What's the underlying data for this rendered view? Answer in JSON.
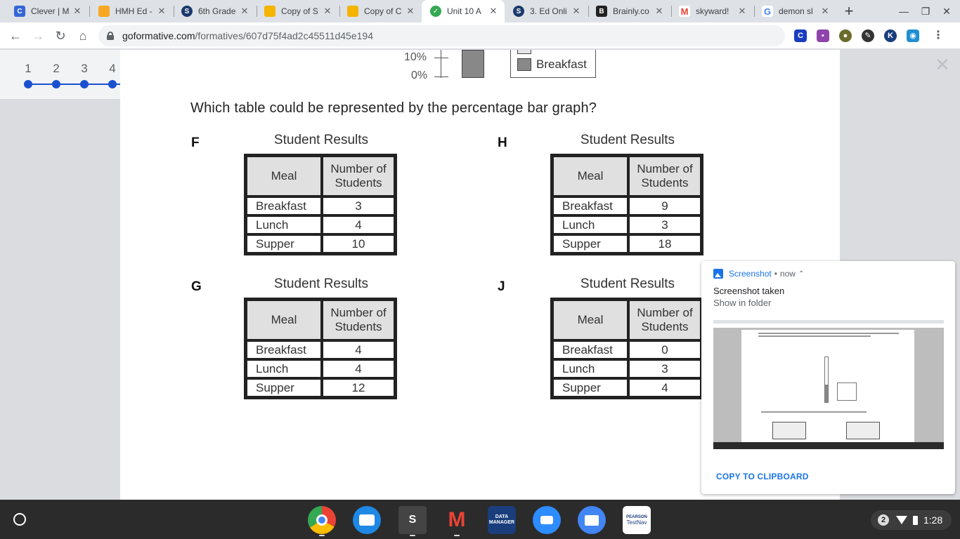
{
  "tabs": [
    {
      "title": "Clever | M",
      "icon": "clever-icon",
      "color": "#3367d6",
      "glyph": "C"
    },
    {
      "title": "HMH Ed -",
      "icon": "hmh-icon",
      "color": "#f6a821",
      "glyph": ""
    },
    {
      "title": "6th Grade",
      "icon": "schoology-icon",
      "color": "#1b3a6b",
      "glyph": "S"
    },
    {
      "title": "Copy of S",
      "icon": "slides-icon",
      "color": "#f4b400",
      "glyph": ""
    },
    {
      "title": "Copy of C",
      "icon": "slides-icon",
      "color": "#f4b400",
      "glyph": ""
    },
    {
      "title": "Unit 10 A",
      "icon": "formative-icon",
      "color": "#34a853",
      "glyph": "✓"
    },
    {
      "title": "3. Ed Onli",
      "icon": "schoology-icon",
      "color": "#1b3a6b",
      "glyph": "S"
    },
    {
      "title": "Brainly.co",
      "icon": "brainly-icon",
      "color": "#222222",
      "glyph": "B"
    },
    {
      "title": "skyward!",
      "icon": "gmail-icon",
      "color": "#ea4335",
      "glyph": "M"
    },
    {
      "title": "demon sl",
      "icon": "google-icon",
      "color": "#4285f4",
      "glyph": "G"
    }
  ],
  "address": {
    "host": "goformative.com",
    "path": "/formatives/607d75f4ad2c45511d45e194"
  },
  "question_nav": [
    "1",
    "2",
    "3",
    "4"
  ],
  "graph": {
    "tick_labels": [
      "10%",
      "0%"
    ],
    "key": [
      "Breakfast"
    ]
  },
  "question": "Which table could be represented by the percentage bar graph?",
  "options": [
    {
      "letter": "F",
      "title": "Student Results",
      "col1": "Meal",
      "col2a": "Number of",
      "col2b": "Students",
      "rows": [
        {
          "meal": "Breakfast",
          "n": "3"
        },
        {
          "meal": "Lunch",
          "n": "4"
        },
        {
          "meal": "Supper",
          "n": "10"
        }
      ]
    },
    {
      "letter": "H",
      "title": "Student Results",
      "col1": "Meal",
      "col2a": "Number of",
      "col2b": "Students",
      "rows": [
        {
          "meal": "Breakfast",
          "n": "9"
        },
        {
          "meal": "Lunch",
          "n": "3"
        },
        {
          "meal": "Supper",
          "n": "18"
        }
      ]
    },
    {
      "letter": "G",
      "title": "Student Results",
      "col1": "Meal",
      "col2a": "Number of",
      "col2b": "Students",
      "rows": [
        {
          "meal": "Breakfast",
          "n": "4"
        },
        {
          "meal": "Lunch",
          "n": "4"
        },
        {
          "meal": "Supper",
          "n": "12"
        }
      ]
    },
    {
      "letter": "J",
      "title": "Student Results",
      "col1": "Meal",
      "col2a": "Number of",
      "col2b": "Students",
      "rows": [
        {
          "meal": "Breakfast",
          "n": "0"
        },
        {
          "meal": "Lunch",
          "n": "3"
        },
        {
          "meal": "Supper",
          "n": "4"
        }
      ]
    }
  ],
  "notification": {
    "app": "Screenshot",
    "when": "now",
    "title": "Screenshot taken",
    "subtitle": "Show in folder",
    "action": "COPY TO CLIPBOARD"
  },
  "shelf": {
    "notification_count": "2",
    "time": "1:28",
    "apps": [
      {
        "name": "chrome-icon",
        "color": "#4285f4",
        "glyph": ""
      },
      {
        "name": "classroom-icon",
        "color": "#1e88e5",
        "glyph": ""
      },
      {
        "name": "schoology-icon",
        "color": "#444444",
        "glyph": "S"
      },
      {
        "name": "gmail-icon",
        "color": "#ffffff",
        "glyph": "M"
      },
      {
        "name": "data-manager-icon",
        "color": "#1a3d7c",
        "glyph": ""
      },
      {
        "name": "zoom-icon",
        "color": "#2d8cff",
        "glyph": ""
      },
      {
        "name": "files-icon",
        "color": "#4285f4",
        "glyph": ""
      },
      {
        "name": "testnav-icon",
        "color": "#ffffff",
        "glyph": ""
      }
    ],
    "testnav_label1": "PEARSON",
    "testnav_label2": "TestNav",
    "datamanager_label": "DATA MANAGER"
  }
}
